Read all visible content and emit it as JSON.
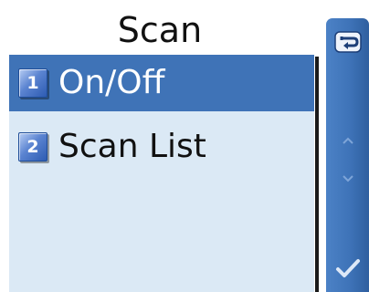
{
  "screen": {
    "title": "Scan"
  },
  "menu": {
    "items": [
      {
        "number": "1",
        "label": "On/Off",
        "selected": true
      },
      {
        "number": "2",
        "label": "Scan List",
        "selected": false
      }
    ]
  },
  "side_bar": {
    "back_icon": "back-arrow-icon",
    "scroll_up_icon": "scroll-up-icon",
    "scroll_down_icon": "scroll-down-icon",
    "ok_icon": "checkmark-icon"
  },
  "colors": {
    "selection": "#3f73b7",
    "list_background": "#dbe9f5",
    "side_bar": "#3e73b8"
  }
}
